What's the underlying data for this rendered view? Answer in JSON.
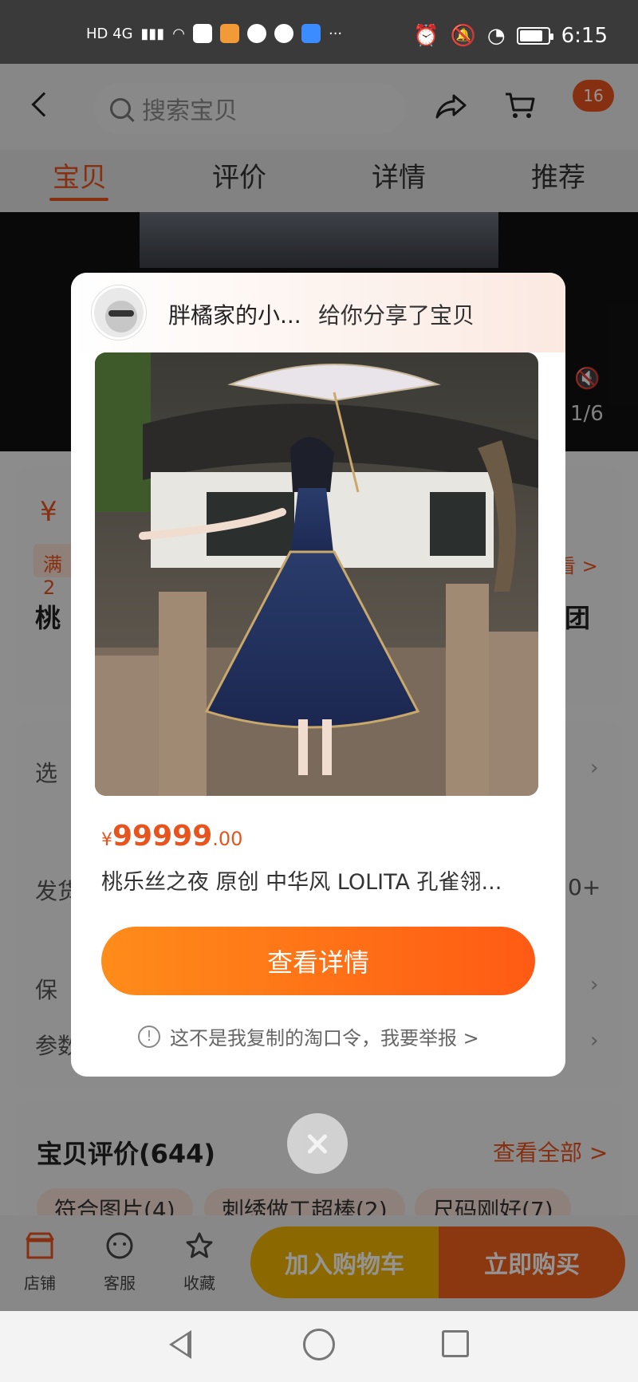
{
  "status_bar": {
    "left_label": "HD 4G",
    "time": "6:15"
  },
  "header": {
    "search_placeholder": "搜索宝贝",
    "cart_badge": "16"
  },
  "tabs": [
    {
      "label": "宝贝",
      "active": true
    },
    {
      "label": "评价",
      "active": false
    },
    {
      "label": "详情",
      "active": false
    },
    {
      "label": "推荐",
      "active": false
    }
  ],
  "media": {
    "counter": "1/6"
  },
  "background": {
    "price_partial": "¥",
    "coupon_partial": "满2",
    "title_left_partial": "桃",
    "title_right_partial": "团",
    "more_partial": "看 >",
    "rows": [
      {
        "label": "选"
      },
      {
        "label": "发货",
        "value": "0+"
      },
      {
        "label": "保"
      },
      {
        "label": "参数"
      }
    ],
    "reviews_title": "宝贝评价(644)",
    "view_all": "查看全部 >",
    "tags": [
      "符合图片(4)",
      "刺绣做工超棒(2)",
      "尺码刚好(7)"
    ]
  },
  "bottom_bar": {
    "shop": "店铺",
    "service": "客服",
    "favorite": "收藏",
    "add_cart": "加入购物车",
    "buy_now": "立即购买"
  },
  "modal": {
    "sharer_name": "胖橘家的小...",
    "share_text": "给你分享了宝贝",
    "price_symbol": "¥",
    "price_integer": "99999",
    "price_decimal": ".00",
    "product_title": "桃乐丝之夜 原创 中华风 LOLITA 孔雀翎...",
    "detail_button": "查看详情",
    "report_text": "这不是我复制的淘口令，我要举报 >"
  },
  "colors": {
    "accent": "#e8541e",
    "cart_button": "#f1b400",
    "buy_button": "#f0601c"
  }
}
